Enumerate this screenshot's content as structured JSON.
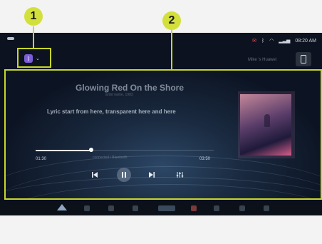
{
  "callouts": {
    "one": "1",
    "two": "2"
  },
  "status_bar": {
    "time": "08:20 AM"
  },
  "header": {
    "device_name": "Mike 's Huawei"
  },
  "track": {
    "title": "Glowing Red On the Shore",
    "artist": "artist name, 1983",
    "lyric": "Lyric start from here, transparent here and here"
  },
  "player": {
    "elapsed": "01:30",
    "duration": "03:50",
    "progress_fraction": 0.31,
    "source_label": "connected / Bluetooth"
  },
  "colors": {
    "accent": "#7b5cd6",
    "callout": "#d3e03b",
    "frame": "#c8d62a"
  },
  "icons": [
    "bluetooth-icon",
    "chevron-down-icon",
    "phone-icon",
    "previous-icon",
    "pause-icon",
    "next-icon",
    "equalizer-icon"
  ]
}
